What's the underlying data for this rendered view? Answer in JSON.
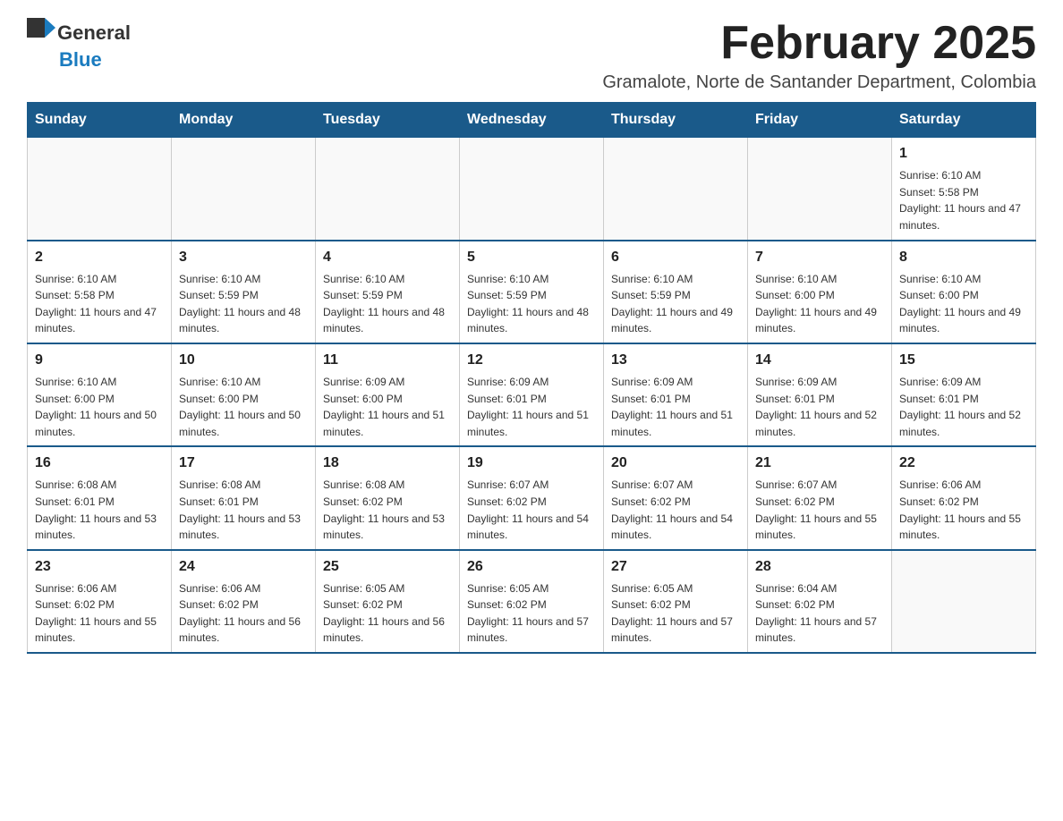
{
  "header": {
    "logo_general": "General",
    "logo_blue": "Blue",
    "month_title": "February 2025",
    "subtitle": "Gramalote, Norte de Santander Department, Colombia"
  },
  "weekdays": [
    "Sunday",
    "Monday",
    "Tuesday",
    "Wednesday",
    "Thursday",
    "Friday",
    "Saturday"
  ],
  "weeks": [
    [
      {
        "day": "",
        "sunrise": "",
        "sunset": "",
        "daylight": ""
      },
      {
        "day": "",
        "sunrise": "",
        "sunset": "",
        "daylight": ""
      },
      {
        "day": "",
        "sunrise": "",
        "sunset": "",
        "daylight": ""
      },
      {
        "day": "",
        "sunrise": "",
        "sunset": "",
        "daylight": ""
      },
      {
        "day": "",
        "sunrise": "",
        "sunset": "",
        "daylight": ""
      },
      {
        "day": "",
        "sunrise": "",
        "sunset": "",
        "daylight": ""
      },
      {
        "day": "1",
        "sunrise": "Sunrise: 6:10 AM",
        "sunset": "Sunset: 5:58 PM",
        "daylight": "Daylight: 11 hours and 47 minutes."
      }
    ],
    [
      {
        "day": "2",
        "sunrise": "Sunrise: 6:10 AM",
        "sunset": "Sunset: 5:58 PM",
        "daylight": "Daylight: 11 hours and 47 minutes."
      },
      {
        "day": "3",
        "sunrise": "Sunrise: 6:10 AM",
        "sunset": "Sunset: 5:59 PM",
        "daylight": "Daylight: 11 hours and 48 minutes."
      },
      {
        "day": "4",
        "sunrise": "Sunrise: 6:10 AM",
        "sunset": "Sunset: 5:59 PM",
        "daylight": "Daylight: 11 hours and 48 minutes."
      },
      {
        "day": "5",
        "sunrise": "Sunrise: 6:10 AM",
        "sunset": "Sunset: 5:59 PM",
        "daylight": "Daylight: 11 hours and 48 minutes."
      },
      {
        "day": "6",
        "sunrise": "Sunrise: 6:10 AM",
        "sunset": "Sunset: 5:59 PM",
        "daylight": "Daylight: 11 hours and 49 minutes."
      },
      {
        "day": "7",
        "sunrise": "Sunrise: 6:10 AM",
        "sunset": "Sunset: 6:00 PM",
        "daylight": "Daylight: 11 hours and 49 minutes."
      },
      {
        "day": "8",
        "sunrise": "Sunrise: 6:10 AM",
        "sunset": "Sunset: 6:00 PM",
        "daylight": "Daylight: 11 hours and 49 minutes."
      }
    ],
    [
      {
        "day": "9",
        "sunrise": "Sunrise: 6:10 AM",
        "sunset": "Sunset: 6:00 PM",
        "daylight": "Daylight: 11 hours and 50 minutes."
      },
      {
        "day": "10",
        "sunrise": "Sunrise: 6:10 AM",
        "sunset": "Sunset: 6:00 PM",
        "daylight": "Daylight: 11 hours and 50 minutes."
      },
      {
        "day": "11",
        "sunrise": "Sunrise: 6:09 AM",
        "sunset": "Sunset: 6:00 PM",
        "daylight": "Daylight: 11 hours and 51 minutes."
      },
      {
        "day": "12",
        "sunrise": "Sunrise: 6:09 AM",
        "sunset": "Sunset: 6:01 PM",
        "daylight": "Daylight: 11 hours and 51 minutes."
      },
      {
        "day": "13",
        "sunrise": "Sunrise: 6:09 AM",
        "sunset": "Sunset: 6:01 PM",
        "daylight": "Daylight: 11 hours and 51 minutes."
      },
      {
        "day": "14",
        "sunrise": "Sunrise: 6:09 AM",
        "sunset": "Sunset: 6:01 PM",
        "daylight": "Daylight: 11 hours and 52 minutes."
      },
      {
        "day": "15",
        "sunrise": "Sunrise: 6:09 AM",
        "sunset": "Sunset: 6:01 PM",
        "daylight": "Daylight: 11 hours and 52 minutes."
      }
    ],
    [
      {
        "day": "16",
        "sunrise": "Sunrise: 6:08 AM",
        "sunset": "Sunset: 6:01 PM",
        "daylight": "Daylight: 11 hours and 53 minutes."
      },
      {
        "day": "17",
        "sunrise": "Sunrise: 6:08 AM",
        "sunset": "Sunset: 6:01 PM",
        "daylight": "Daylight: 11 hours and 53 minutes."
      },
      {
        "day": "18",
        "sunrise": "Sunrise: 6:08 AM",
        "sunset": "Sunset: 6:02 PM",
        "daylight": "Daylight: 11 hours and 53 minutes."
      },
      {
        "day": "19",
        "sunrise": "Sunrise: 6:07 AM",
        "sunset": "Sunset: 6:02 PM",
        "daylight": "Daylight: 11 hours and 54 minutes."
      },
      {
        "day": "20",
        "sunrise": "Sunrise: 6:07 AM",
        "sunset": "Sunset: 6:02 PM",
        "daylight": "Daylight: 11 hours and 54 minutes."
      },
      {
        "day": "21",
        "sunrise": "Sunrise: 6:07 AM",
        "sunset": "Sunset: 6:02 PM",
        "daylight": "Daylight: 11 hours and 55 minutes."
      },
      {
        "day": "22",
        "sunrise": "Sunrise: 6:06 AM",
        "sunset": "Sunset: 6:02 PM",
        "daylight": "Daylight: 11 hours and 55 minutes."
      }
    ],
    [
      {
        "day": "23",
        "sunrise": "Sunrise: 6:06 AM",
        "sunset": "Sunset: 6:02 PM",
        "daylight": "Daylight: 11 hours and 55 minutes."
      },
      {
        "day": "24",
        "sunrise": "Sunrise: 6:06 AM",
        "sunset": "Sunset: 6:02 PM",
        "daylight": "Daylight: 11 hours and 56 minutes."
      },
      {
        "day": "25",
        "sunrise": "Sunrise: 6:05 AM",
        "sunset": "Sunset: 6:02 PM",
        "daylight": "Daylight: 11 hours and 56 minutes."
      },
      {
        "day": "26",
        "sunrise": "Sunrise: 6:05 AM",
        "sunset": "Sunset: 6:02 PM",
        "daylight": "Daylight: 11 hours and 57 minutes."
      },
      {
        "day": "27",
        "sunrise": "Sunrise: 6:05 AM",
        "sunset": "Sunset: 6:02 PM",
        "daylight": "Daylight: 11 hours and 57 minutes."
      },
      {
        "day": "28",
        "sunrise": "Sunrise: 6:04 AM",
        "sunset": "Sunset: 6:02 PM",
        "daylight": "Daylight: 11 hours and 57 minutes."
      },
      {
        "day": "",
        "sunrise": "",
        "sunset": "",
        "daylight": ""
      }
    ]
  ]
}
